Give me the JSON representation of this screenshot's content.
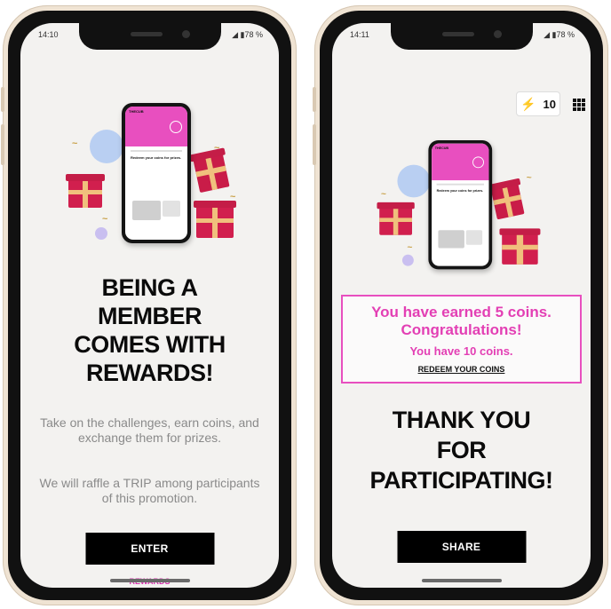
{
  "left": {
    "status": {
      "time": "14:10",
      "battery": "◢ ▮78 %"
    },
    "headline": [
      "BEING A",
      "MEMBER",
      "COMES WITH",
      "REWARDS!"
    ],
    "body_1": "Take on the challenges, earn coins, and exchange them for prizes.",
    "body_2": "We will raffle a TRIP among participants of this promotion.",
    "button": "ENTER",
    "link": "REWARDS",
    "mini": {
      "brand": "THECUB",
      "title": "Redeem your coins for prizes."
    }
  },
  "right": {
    "status": {
      "time": "14:11",
      "battery": "◢ ▮78 %"
    },
    "coins": "10",
    "earned_line_1": "You have earned 5 coins.",
    "earned_line_2": "Congratulations!",
    "earned_line_3": "You have 10 coins.",
    "redeem_link": "REDEEM YOUR COINS",
    "headline": [
      "THANK YOU",
      "FOR",
      "PARTICIPATING!"
    ],
    "button": "SHARE",
    "mini": {
      "brand": "THECUB",
      "title": "Redeem your coins for prizes."
    }
  },
  "colors": {
    "accent": "#e33fb4",
    "frame": "#efe3d3",
    "screen": "#f3f2f0"
  },
  "icons": {
    "bolt": "lightning-icon",
    "menu": "grid-menu-icon"
  }
}
